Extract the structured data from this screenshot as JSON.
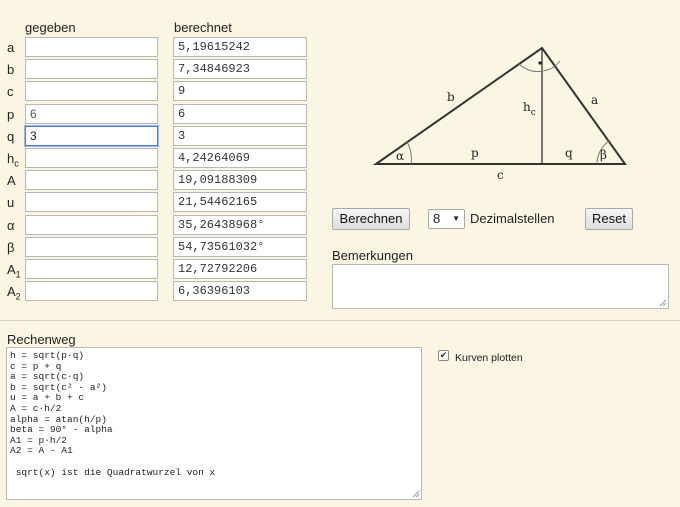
{
  "headers": {
    "given": "gegeben",
    "computed": "berechnet"
  },
  "rows": [
    {
      "label": "a",
      "given": "",
      "computed": "5,19615242"
    },
    {
      "label": "b",
      "given": "",
      "computed": "7,34846923"
    },
    {
      "label": "c",
      "given": "",
      "computed": "9"
    },
    {
      "label": "p",
      "given": "6",
      "computed": "6"
    },
    {
      "label": "q",
      "given": "3",
      "computed": "3"
    },
    {
      "label": "h",
      "sub": "c",
      "given": "",
      "computed": "4,24264069"
    },
    {
      "label": "A",
      "given": "",
      "computed": "19,09188309"
    },
    {
      "label": "u",
      "given": "",
      "computed": "21,54462165"
    },
    {
      "label": "α",
      "given": "",
      "computed": "35,26438968°"
    },
    {
      "label": "β",
      "given": "",
      "computed": "54,73561032°"
    },
    {
      "label": "A",
      "sub": "1",
      "given": "",
      "computed": "12,72792206"
    },
    {
      "label": "A",
      "sub": "2",
      "given": "",
      "computed": "6,36396103"
    }
  ],
  "diagram": {
    "side_a": "a",
    "side_b": "b",
    "side_c": "c",
    "seg_p": "p",
    "seg_q": "q",
    "height": "h",
    "height_sub": "c",
    "angle_alpha": "α",
    "angle_beta": "β"
  },
  "controls": {
    "calculate_label": "Berechnen",
    "decimals_value": "8",
    "decimals_label": "Dezimalstellen",
    "reset_label": "Reset"
  },
  "remarks": {
    "title": "Bemerkungen",
    "text": ""
  },
  "solution": {
    "title": "Rechenweg",
    "text": "h = sqrt(p·q)\nc = p + q\na = sqrt(c·q)\nb = sqrt(c² - a²)\nu = a + b + c\nA = c·h/2\nalpha = atan(h/p)\nbeta = 90° - alpha\nA1 = p·h/2\nA2 = A - A1\n\n sqrt(x) ist die Quadratwurzel von x"
  },
  "plot": {
    "label": "Kurven plotten",
    "checked": true
  }
}
